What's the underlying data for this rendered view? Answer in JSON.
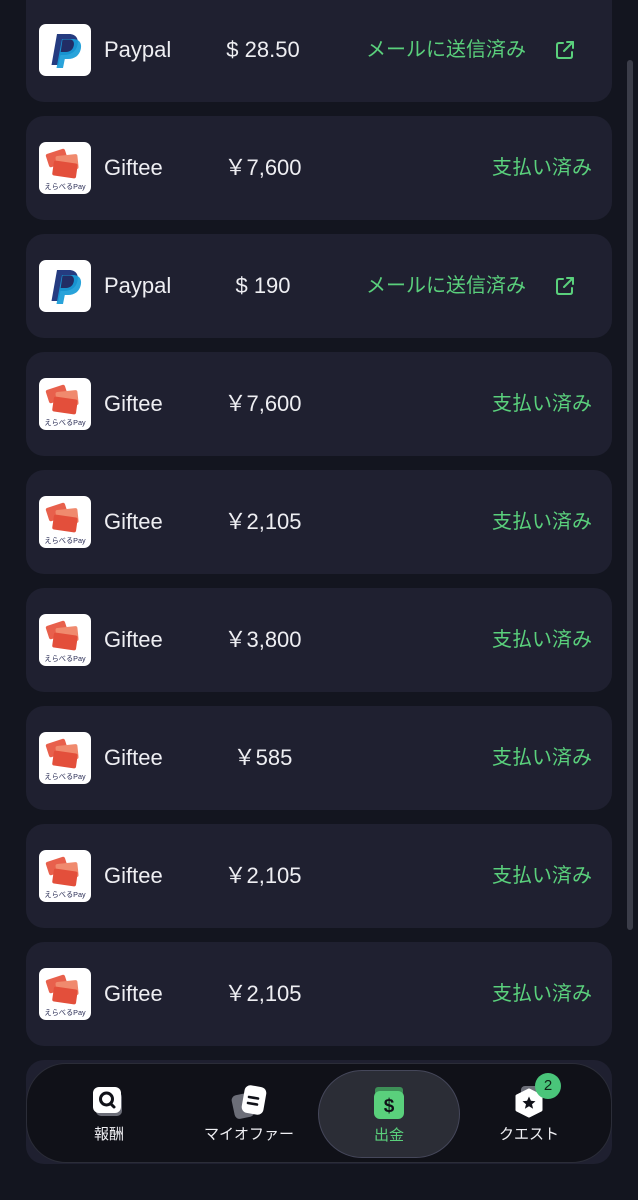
{
  "payouts": [
    {
      "method": "Paypal",
      "amount": "$ 28.50",
      "status": "メールに送信済み",
      "logo": "paypal-logo",
      "link_icon": "external-link-icon"
    },
    {
      "method": "Giftee",
      "amount": "￥7,600",
      "status": "支払い済み",
      "logo": "giftee-erabel-pay-logo"
    },
    {
      "method": "Paypal",
      "amount": "$ 190",
      "status": "メールに送信済み",
      "logo": "paypal-logo",
      "link_icon": "external-link-icon"
    },
    {
      "method": "Giftee",
      "amount": "￥7,600",
      "status": "支払い済み",
      "logo": "giftee-erabel-pay-logo"
    },
    {
      "method": "Giftee",
      "amount": "￥2,105",
      "status": "支払い済み",
      "logo": "giftee-erabel-pay-logo"
    },
    {
      "method": "Giftee",
      "amount": "￥3,800",
      "status": "支払い済み",
      "logo": "giftee-erabel-pay-logo"
    },
    {
      "method": "Giftee",
      "amount": "￥585",
      "status": "支払い済み",
      "logo": "giftee-erabel-pay-logo"
    },
    {
      "method": "Giftee",
      "amount": "￥2,105",
      "status": "支払い済み",
      "logo": "giftee-erabel-pay-logo"
    },
    {
      "method": "Giftee",
      "amount": "￥2,105",
      "status": "支払い済み",
      "logo": "giftee-erabel-pay-logo"
    }
  ],
  "giftee_logo_text": "えらべるPay",
  "nav": {
    "items": [
      {
        "label": "報酬",
        "icon": "search-icon"
      },
      {
        "label": "マイオファー",
        "icon": "offers-icon"
      },
      {
        "label": "出金",
        "icon": "wallet-dollar-icon",
        "active": true
      },
      {
        "label": "クエスト",
        "icon": "quest-star-icon",
        "badge": "2"
      }
    ]
  },
  "colors": {
    "background": "#13151f",
    "card": "#1f2030",
    "status_green": "#5ad07c",
    "text": "#eeeef2",
    "paypal_dark": "#253b80",
    "paypal_light": "#179bd7",
    "giftee_red": "#e8604c"
  }
}
